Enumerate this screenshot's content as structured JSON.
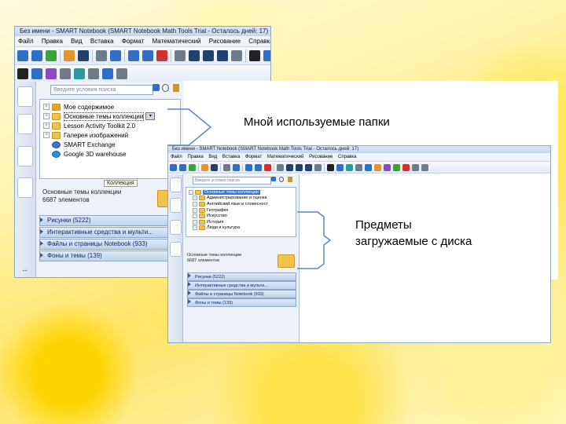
{
  "back_window": {
    "title": "Без имени - SMART Notebook (SMART Notebook Math Tools Trial - Осталось дней: 17)",
    "menu": [
      "Файл",
      "Правка",
      "Вид",
      "Вставка",
      "Формат",
      "Математический",
      "Рисование",
      "Справка"
    ],
    "search_placeholder": "Введите условия поиска",
    "tree": [
      {
        "label": "Мое содержимое",
        "type": "star"
      },
      {
        "label": "Основные темы коллекции",
        "type": "folder",
        "selected": true
      },
      {
        "label": "Lesson Activity Toolkit 2.0",
        "type": "folder"
      },
      {
        "label": "Галерея изображений",
        "type": "folder"
      },
      {
        "label": "SMART Exchange",
        "type": "exchange"
      },
      {
        "label": "Google 3D warehouse",
        "type": "globe"
      }
    ],
    "tooltip": "Коллекция",
    "collection_title": "Основные темы коллекции",
    "collection_count": "6687 элементов",
    "accordion": [
      "Рисунки (5222)",
      "Интерактивные средства и мульти...",
      "Файлы и страницы Notebook (933)",
      "Фоны и темы (139)"
    ]
  },
  "front_window": {
    "title": "Без имени - SMART Notebook (SMART Notebook Math Tools Trial - Осталось дней: 17)",
    "menu": [
      "Файл",
      "Правка",
      "Вид",
      "Вставка",
      "Формат",
      "Математический",
      "Рисование",
      "Справка"
    ],
    "search_placeholder": "Введите условия поиска",
    "tree": [
      {
        "label": "Основные темы коллекции",
        "selected": true
      },
      {
        "label": "Администрирование и оценка"
      },
      {
        "label": "Английский язык и словесност"
      },
      {
        "label": "География"
      },
      {
        "label": "Искусство"
      },
      {
        "label": "История"
      },
      {
        "label": "Люди и культура"
      }
    ],
    "collection_title": "Основные темы коллекции",
    "collection_count": "6687 элементов",
    "accordion": [
      "Рисунки (5222)",
      "Интерактивные средства и мульти...",
      "Файлы и страницы Notebook (933)",
      "Фоны и темы (139)"
    ]
  },
  "callouts": {
    "folders": "Мной используемые папки",
    "items_line1": "Предметы",
    "items_line2": "загружаемые с диска"
  },
  "colors": {
    "bracket": "#5a86c2",
    "accent": "#3d73c8"
  }
}
